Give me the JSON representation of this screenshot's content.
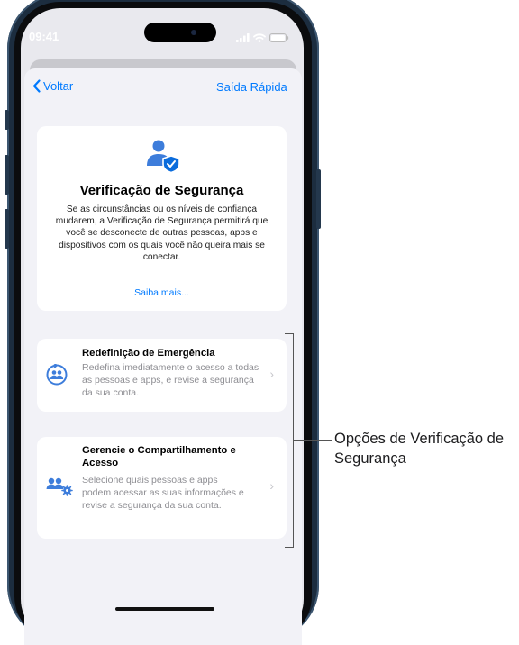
{
  "status": {
    "time": "09:41"
  },
  "nav": {
    "back_label": "Voltar",
    "exit_label": "Saída Rápida"
  },
  "intro": {
    "title": "Verificação de Segurança",
    "description": "Se as circunstâncias ou os níveis de confiança mudarem, a Verificação de Segurança permitirá que você se desconecte de outras pessoas, apps e dispositivos com os quais você não queira mais se conectar.",
    "learn_more": "Saiba mais..."
  },
  "options": [
    {
      "title": "Redefinição de Emergência",
      "description": "Redefina imediatamente o acesso a todas as pessoas e apps, e revise a segurança da sua conta.",
      "icon": "emergency-reset-icon"
    },
    {
      "title": "Gerencie o Compartilhamento e Acesso",
      "description": "Selecione quais pessoas e apps podem acessar as suas informações e revise a segurança da sua conta.",
      "icon": "people-gear-icon"
    }
  ],
  "callout": {
    "text": "Opções de Verificação de Segurança"
  },
  "colors": {
    "accent": "#007aff",
    "icon_blue": "#3d7ddb",
    "background": "#f2f2f7"
  }
}
